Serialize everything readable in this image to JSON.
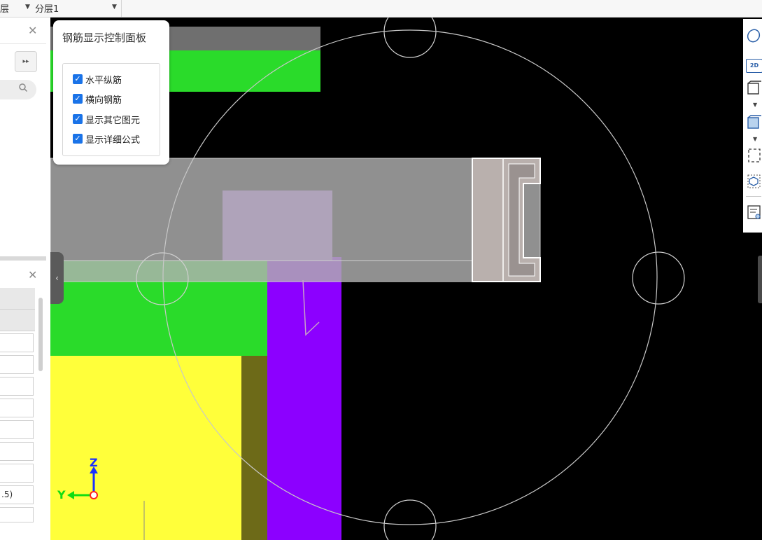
{
  "topbar": {
    "text1": "层",
    "layer_select": "分层1"
  },
  "left_panel": {
    "expand_button": "▸▸",
    "value_row": ".5)"
  },
  "control_panel": {
    "title": "钢筋显示控制面板",
    "options": [
      {
        "label": "水平纵筋",
        "checked": true
      },
      {
        "label": "横向钢筋",
        "checked": true
      },
      {
        "label": "显示其它图元",
        "checked": true
      },
      {
        "label": "显示详细公式",
        "checked": true
      }
    ]
  },
  "axes": {
    "z_label": "Z",
    "y_label": "Y"
  },
  "right_toolbar": {
    "icons": [
      "orbit-icon",
      "2d-view-icon",
      "cube-outline-icon",
      "cube-filled-icon",
      "box-select-icon",
      "3d-box-icon",
      "list-settings-icon"
    ],
    "view_2d_label": "2D"
  },
  "colors": {
    "green": "#2adb2a",
    "yellow": "#ffff3a",
    "olive": "#6d6a18",
    "violet": "#8c00ff",
    "lilac": "#ad68e8",
    "grey_beam": "#9d9d9d",
    "checkbox": "#1a73e8"
  }
}
